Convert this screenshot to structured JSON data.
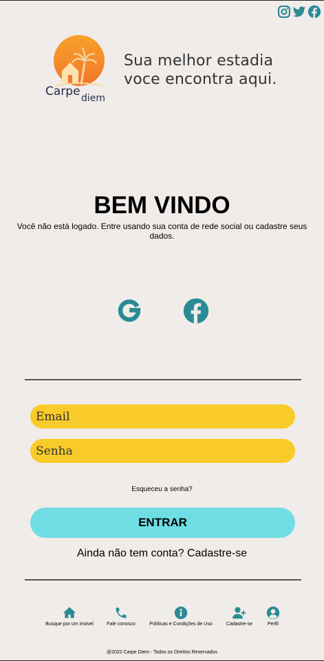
{
  "header": {
    "social_icons": [
      "instagram-icon",
      "twitter-icon",
      "facebook-icon"
    ],
    "brand": {
      "word1": "Carpe",
      "word2": "diem"
    },
    "tagline_line1": "Sua melhor estadia",
    "tagline_line2": "voce encontra aqui."
  },
  "login": {
    "title": "BEM VINDO",
    "subtitle": "Você não está logado. Entre usando sua conta de rede social ou cadastre seus dados.",
    "social_login": [
      "google-icon",
      "facebook-icon"
    ],
    "email_placeholder": "Email",
    "password_placeholder": "Senha",
    "forgot": "Esqueceu a senha?",
    "submit": "ENTRAR",
    "signup": "Ainda não tem conta? Cadastre-se"
  },
  "nav": {
    "items": [
      {
        "label": "Busque por um imóvel",
        "icon": "home-icon"
      },
      {
        "label": "Fale conosco",
        "icon": "phone-icon"
      },
      {
        "label": "Políticas e Condições de Uso",
        "icon": "info-icon"
      },
      {
        "label": "Cadastre-se",
        "icon": "user-plus-icon"
      },
      {
        "label": "Perfil",
        "icon": "user-circle-icon"
      }
    ]
  },
  "footer": {
    "copyright": "@2022 Carpe Diem - Todos os Direitos Reservados"
  },
  "colors": {
    "teal": "#2a8b94",
    "yellow": "#f9cb2a",
    "cyan": "#6edde4",
    "background": "#f0ecea"
  }
}
